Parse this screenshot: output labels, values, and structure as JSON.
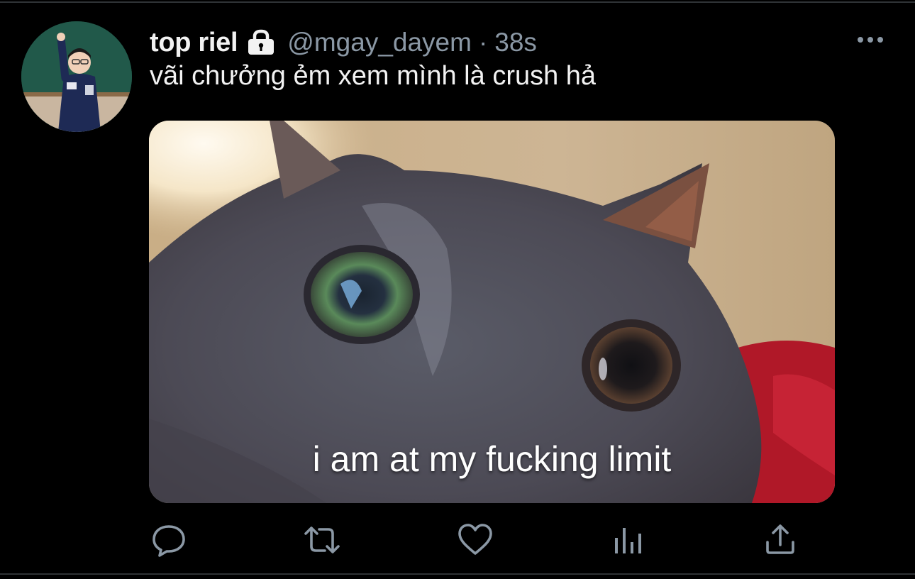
{
  "tweet": {
    "display_name": "top riel",
    "locked_icon": "lock-icon",
    "handle": "@mgay_dayem",
    "separator": "·",
    "time_ago": "38s",
    "text": "vãi chưởng ẻm xem mình là crush hả",
    "more_icon": "more-icon"
  },
  "media": {
    "caption": "i am at my fucking limit"
  },
  "actions": [
    {
      "name": "reply",
      "icon": "reply-icon"
    },
    {
      "name": "retweet",
      "icon": "retweet-icon"
    },
    {
      "name": "like",
      "icon": "heart-icon"
    },
    {
      "name": "analytics",
      "icon": "analytics-icon"
    },
    {
      "name": "share",
      "icon": "share-icon"
    }
  ],
  "colors": {
    "background": "#000000",
    "text_primary": "#f2f2f2",
    "text_secondary": "#8b98a5",
    "icon": "#8b98a5"
  }
}
